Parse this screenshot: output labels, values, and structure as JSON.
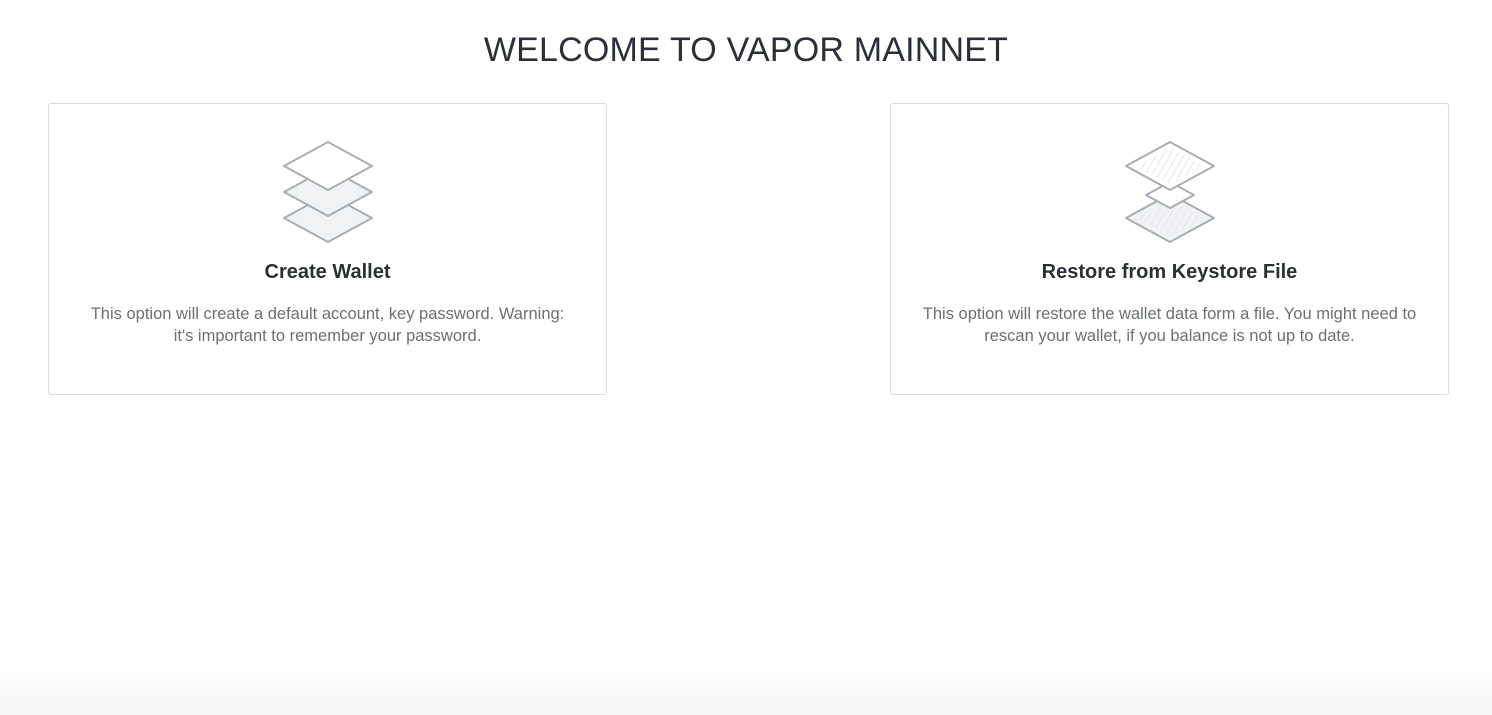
{
  "page": {
    "title": "WELCOME TO VAPOR MAINNET"
  },
  "options": {
    "create": {
      "icon": "layers-icon",
      "title": "Create Wallet",
      "description": "This option will create a default account, key password. Warning: it's important to remember your password."
    },
    "restore": {
      "icon": "layers-split-icon",
      "title": "Restore from Keystore File",
      "description": "This option will restore the wallet data form a file. You might need to rescan your wallet, if you balance is not up to date."
    }
  },
  "colors": {
    "title_text": "#2b2f38",
    "description_text": "#6b6f78",
    "card_border": "#d9dbe0",
    "icon_stroke": "#a9adb8",
    "icon_fill": "#f1f2f4"
  }
}
